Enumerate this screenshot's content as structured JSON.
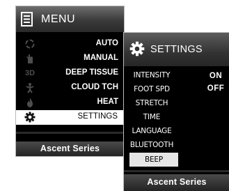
{
  "menu": {
    "title": "MENU",
    "items": [
      {
        "label": "AUTO",
        "icon": "auto-icon"
      },
      {
        "label": "MANUAL",
        "icon": "hand-icon"
      },
      {
        "label": "DEEP TISSUE",
        "icon": "3d-icon",
        "icon_text": "3D"
      },
      {
        "label": "CLOUD TCH",
        "icon": "body-icon"
      },
      {
        "label": "HEAT",
        "icon": "flame-icon"
      },
      {
        "label": "SETTINGS",
        "icon": "gear-icon",
        "selected": true
      }
    ],
    "footer": "Ascent Series"
  },
  "settings": {
    "title": "SETTINGS",
    "items": [
      {
        "label": "INTENSITY"
      },
      {
        "label": "FOOT SPD"
      },
      {
        "label": "STRETCH"
      },
      {
        "label": "TIME"
      },
      {
        "label": "LANGUAGE"
      },
      {
        "label": "BLUETOOTH"
      },
      {
        "label": "BEEP",
        "selected": true
      }
    ],
    "options": [
      "ON",
      "OFF"
    ],
    "footer": "Ascent Series"
  },
  "colors": {
    "screen_bg": "#000000",
    "selection_bg": "#ffffff",
    "settings_selection_bg": "#e6e6e6",
    "inactive_icon": "#4d4d4d"
  }
}
